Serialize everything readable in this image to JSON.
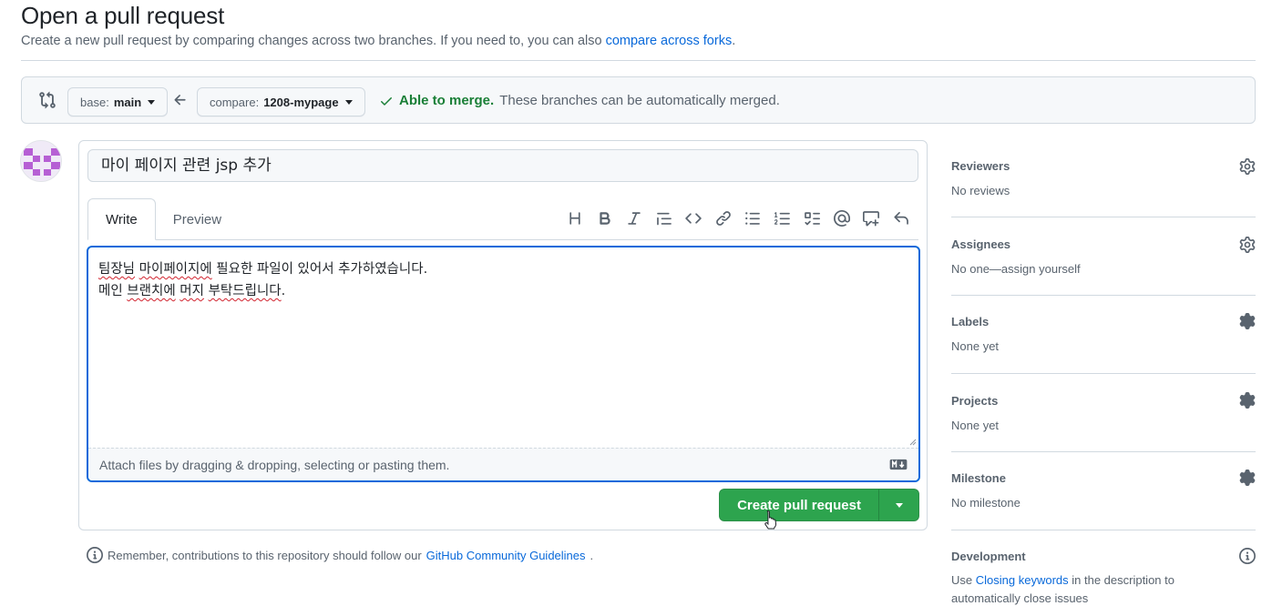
{
  "header": {
    "title": "Open a pull request",
    "subtitle": "Create a new pull request by comparing changes across two branches. If you need to, you can also",
    "subtitle_link": "compare across forks",
    "subtitle_end": "."
  },
  "compare": {
    "base_prefix": "base:",
    "base_branch": "main",
    "compare_prefix": "compare:",
    "compare_branch": "1208-mypage",
    "merge_ok": "Able to merge.",
    "merge_msg": "These branches can be automatically merged."
  },
  "form": {
    "title_value": "마이 페이지 관련 jsp 추가",
    "tabs": [
      "Write",
      "Preview"
    ],
    "body_line1_a": "팀장님",
    "body_line1_b": "마이페이지에",
    "body_line1_c": " 필요한 파일이 있어서 추가하였습니다.",
    "body_line2_a": "메인 ",
    "body_line2_b": "브랜치에",
    "body_line2_c": " ",
    "body_line2_d": "머지",
    "body_line2_e": " ",
    "body_line2_f": "부탁드립니다",
    "body_line2_g": ".",
    "attach_hint": "Attach files by dragging & dropping, selecting or pasting them.",
    "submit_label": "Create pull request"
  },
  "toolbar_icons": [
    "heading-icon",
    "bold-icon",
    "italic-icon",
    "quote-icon",
    "code-icon",
    "link-icon",
    "unordered-list-icon",
    "ordered-list-icon",
    "task-list-icon",
    "mention-icon",
    "reference-icon",
    "reply-icon"
  ],
  "footer": {
    "remember_text": "Remember, contributions to this repository should follow our",
    "remember_link": "GitHub Community Guidelines",
    "remember_end": "."
  },
  "sidebar": {
    "reviewers": {
      "label": "Reviewers",
      "value": "No reviews"
    },
    "assignees": {
      "label": "Assignees",
      "value": "No one—assign yourself"
    },
    "labels": {
      "label": "Labels",
      "value": "None yet"
    },
    "projects": {
      "label": "Projects",
      "value": "None yet"
    },
    "milestone": {
      "label": "Milestone",
      "value": "No milestone"
    },
    "development": {
      "label": "Development",
      "text_a": "Use",
      "link": "Closing keywords",
      "text_b": "in the description to",
      "text_c": "automatically close issues"
    }
  },
  "colors": {
    "accent": "#0969da",
    "success": "#1a7f37",
    "button_green": "#2da44e",
    "muted": "#59636e",
    "border": "#d1d9e0"
  }
}
